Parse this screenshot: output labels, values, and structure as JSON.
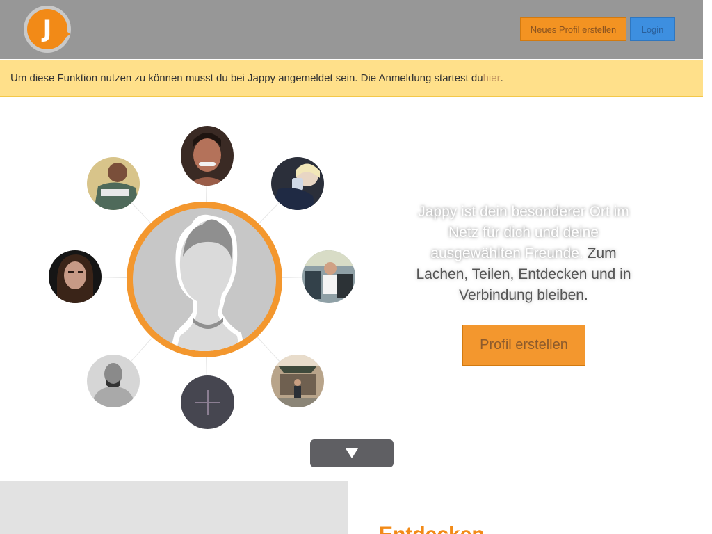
{
  "header": {
    "logo_letter": "J",
    "new_profile_label": "Neues Profil erstellen",
    "login_label": "Login"
  },
  "notice": {
    "text": "Um diese Funktion nutzen zu können musst du bei Jappy angemeldet sein. Die Anmeldung startest du ",
    "link_label": "hier",
    "suffix": "."
  },
  "hero": {
    "tagline_highlight": "Jappy ist dein besonderer Ort im Netz für dich und deine ausgewählten Freunde.",
    "tagline_rest": " Zum Lachen, Teilen, Entdecken und in Verbindung bleiben.",
    "cta_label": "Profil erstellen"
  },
  "section2": {
    "heading": "Entdecken"
  },
  "colors": {
    "brand_orange": "#f3972e",
    "login_blue": "#3d8fe0",
    "notice_bg": "#ffe08a"
  },
  "icons": {
    "plus": "plus-icon",
    "scroll": "triangle-down-icon"
  }
}
